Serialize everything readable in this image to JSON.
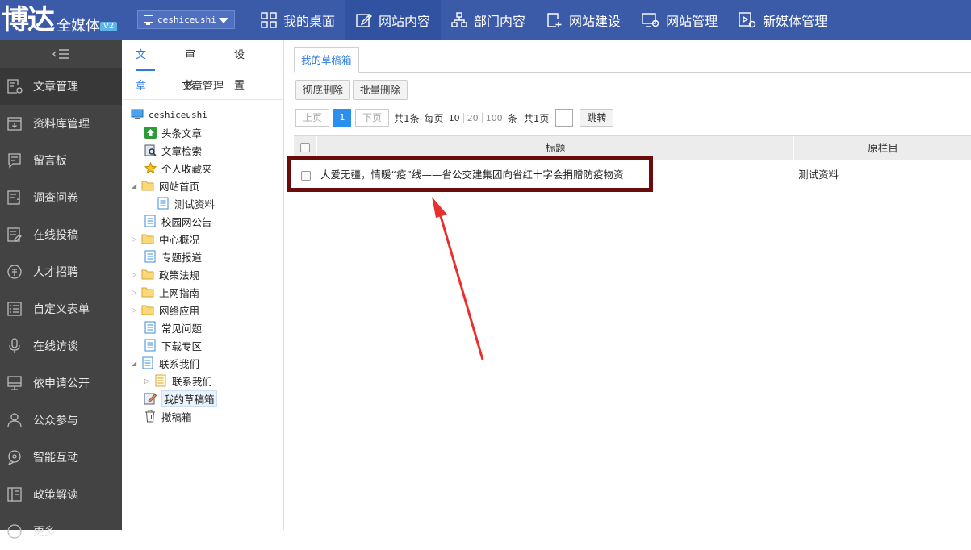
{
  "header": {
    "logo_main": "博达",
    "logo_sub": "全媒体",
    "logo_badge": "V2",
    "site_select_value": "ceshiceushi",
    "nav": [
      {
        "label": "我的桌面",
        "icon": "desktop-grid-icon",
        "active": false
      },
      {
        "label": "网站内容",
        "icon": "edit-icon",
        "active": true
      },
      {
        "label": "部门内容",
        "icon": "org-chart-icon",
        "active": false
      },
      {
        "label": "网站建设",
        "icon": "build-page-icon",
        "active": false
      },
      {
        "label": "网站管理",
        "icon": "monitor-settings-icon",
        "active": false
      },
      {
        "label": "新媒体管理",
        "icon": "media-icon",
        "active": false
      }
    ]
  },
  "sidebar": {
    "collapse_icon": "collapse-menu-icon",
    "items": [
      {
        "label": "文章管理",
        "icon": "article-manage-icon",
        "active": true
      },
      {
        "label": "资料库管理",
        "icon": "archive-icon",
        "active": false
      },
      {
        "label": "留言板",
        "icon": "message-board-icon",
        "active": false
      },
      {
        "label": "调查问卷",
        "icon": "survey-icon",
        "active": false
      },
      {
        "label": "在线投稿",
        "icon": "submission-icon",
        "active": false
      },
      {
        "label": "人才招聘",
        "icon": "recruit-icon",
        "active": false
      },
      {
        "label": "自定义表单",
        "icon": "form-icon",
        "active": false
      },
      {
        "label": "在线访谈",
        "icon": "microphone-icon",
        "active": false
      },
      {
        "label": "依申请公开",
        "icon": "disclosure-icon",
        "active": false
      },
      {
        "label": "公众参与",
        "icon": "people-icon",
        "active": false
      },
      {
        "label": "智能互动",
        "icon": "interaction-icon",
        "active": false
      },
      {
        "label": "政策解读",
        "icon": "policy-book-icon",
        "active": false
      },
      {
        "label": "更多",
        "icon": "more-icon",
        "active": false
      }
    ]
  },
  "tree_panel": {
    "tabs": [
      {
        "label": "文章",
        "active": true
      },
      {
        "label": "审核",
        "active": false
      },
      {
        "label": "设置",
        "active": false
      }
    ],
    "header": "文章管理",
    "root": "ceshiceushi",
    "nodes": [
      {
        "label": "头条文章",
        "icon": "headline-up-icon"
      },
      {
        "label": "文章检索",
        "icon": "search-doc-icon"
      },
      {
        "label": "个人收藏夹",
        "icon": "star-icon"
      },
      {
        "label": "网站首页",
        "icon": "folder-icon"
      },
      {
        "label": "测试资料",
        "icon": "page-icon"
      },
      {
        "label": "校园网公告",
        "icon": "page-icon"
      },
      {
        "label": "中心概况",
        "icon": "folder-icon"
      },
      {
        "label": "专题报道",
        "icon": "page-icon"
      },
      {
        "label": "政策法规",
        "icon": "folder-icon"
      },
      {
        "label": "上网指南",
        "icon": "folder-icon"
      },
      {
        "label": "网络应用",
        "icon": "folder-icon"
      },
      {
        "label": "常见问题",
        "icon": "page-icon"
      },
      {
        "label": "下载专区",
        "icon": "page-icon"
      },
      {
        "label": "联系我们",
        "icon": "page-icon"
      },
      {
        "label": "联系我们",
        "icon": "page-icon"
      },
      {
        "label": "我的草稿箱",
        "icon": "drafts-icon"
      },
      {
        "label": "撤稿箱",
        "icon": "trash-icon"
      }
    ]
  },
  "content": {
    "tab": "我的草稿箱",
    "buttons": {
      "purge": "彻底删除",
      "batch_delete": "批量删除"
    },
    "pager": {
      "prev": "上页",
      "current": "1",
      "next": "下页",
      "total_items": "共1条",
      "per_page_label": "每页",
      "sizes": [
        "10",
        "20",
        "100"
      ],
      "unit": "条",
      "total_pages": "共1页",
      "goto": "跳转"
    },
    "table": {
      "columns": [
        "标题",
        "原栏目"
      ],
      "rows": [
        {
          "title": "大爱无疆，情暖“疫”线——省公交建集团向省红十字会捐赠防疫物资",
          "column": "测试资料"
        }
      ]
    }
  },
  "colors": {
    "topbar": "#3b5aa8",
    "sidebar": "#434343",
    "accent": "#2b7bd8",
    "annotation_box": "#6b0c0c",
    "annotation_arrow": "#e8312d"
  }
}
